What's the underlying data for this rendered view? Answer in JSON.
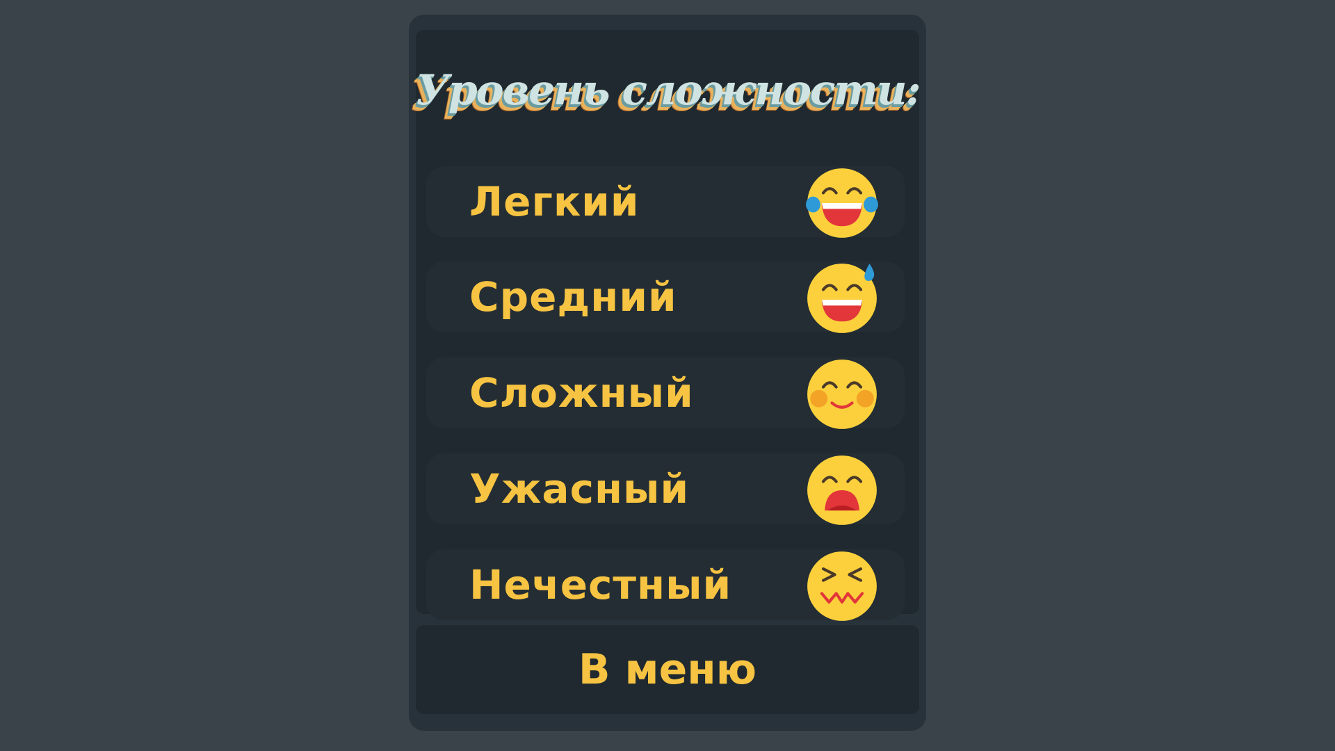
{
  "screen": {
    "title": "Уровень сложности:"
  },
  "levels": [
    {
      "label": "Легкий",
      "icon": "tears-of-joy-emoji-icon"
    },
    {
      "label": "Средний",
      "icon": "grinning-sweat-emoji-icon"
    },
    {
      "label": "Сложный",
      "icon": "blushing-smile-emoji-icon"
    },
    {
      "label": "Ужасный",
      "icon": "anguished-emoji-icon"
    },
    {
      "label": "Нечестный",
      "icon": "confounded-emoji-icon"
    }
  ],
  "menu_button": {
    "label": "В меню"
  },
  "colors": {
    "background": "#394349",
    "panel": "#27323a",
    "inner": "#1f292f",
    "row": "#232d33",
    "text_accent": "#f7c342",
    "emoji_face": "#fcd03c"
  }
}
